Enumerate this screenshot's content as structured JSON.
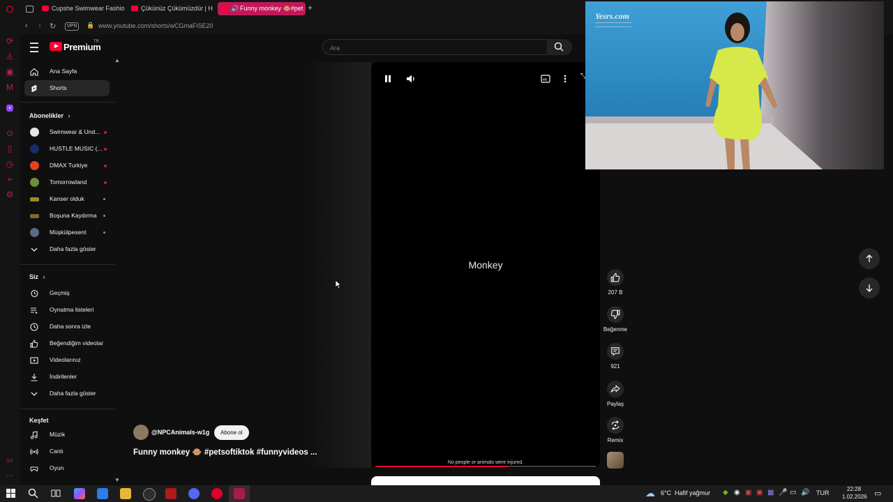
{
  "browser": {
    "tabs": [
      {
        "label": "Cupshe Swimwear Fashio"
      },
      {
        "label": "Çükünüz Çükümüzdür | H"
      },
      {
        "label": "Funny monkey 🐵#pet"
      }
    ],
    "new_tab": "+",
    "vpn_label": "VPN",
    "url": "www.youtube.com/shorts/wCGmaFiSE20"
  },
  "header": {
    "brand": "Premium",
    "brand_sup": "TR",
    "search_placeholder": "Ara"
  },
  "sidebar": {
    "main": [
      {
        "label": "Ana Sayfa",
        "icon": "home-icon"
      },
      {
        "label": "Shorts",
        "icon": "shorts-icon"
      }
    ],
    "subscriptions_title": "Abonelikler",
    "subscriptions": [
      {
        "label": "Swimwear & Und...",
        "color": "#e6e6e6",
        "status": "live"
      },
      {
        "label": "HUSTLE MUSIC (...",
        "color": "#1a2a6c",
        "status": "live"
      },
      {
        "label": "DMAX Turkiye",
        "color": "#e2431d",
        "status": "live"
      },
      {
        "label": "Tomorrowland",
        "color": "#6b8f3a",
        "status": "live"
      },
      {
        "label": "Kanser olduk",
        "color": "#9c8a2a",
        "status": "new"
      },
      {
        "label": "Boşuna Kaydırma",
        "color": "#7a6a2a",
        "status": "new"
      },
      {
        "label": "Müşkülpesent",
        "color": "#5a6a8a",
        "status": "new"
      }
    ],
    "show_more": "Daha fazla göster",
    "you_title": "Siz",
    "you": [
      {
        "label": "Geçmiş",
        "icon": "history-icon"
      },
      {
        "label": "Oynatma listeleri",
        "icon": "playlist-icon"
      },
      {
        "label": "Daha sonra izle",
        "icon": "clock-icon"
      },
      {
        "label": "Beğendiğim videolar",
        "icon": "thumbs-up-icon"
      },
      {
        "label": "Videolarınız",
        "icon": "video-icon"
      },
      {
        "label": "İndirilenler",
        "icon": "download-icon"
      }
    ],
    "show_more_2": "Daha fazla göster",
    "explore_title": "Keşfet",
    "explore": [
      {
        "label": "Müzik",
        "icon": "music-icon"
      },
      {
        "label": "Canlı",
        "icon": "live-icon"
      },
      {
        "label": "Oyun",
        "icon": "gaming-icon"
      }
    ]
  },
  "video": {
    "center_text": "Monkey",
    "caption": "No people or animals were injured.",
    "progress": 0.6
  },
  "channel": {
    "handle": "@NPCAnimals-w1g",
    "subscribe_label": "Abone ol",
    "title": "Funny monkey 🐵 #petsoftiktok #funnyvideos ..."
  },
  "actions": {
    "likes": "207 B",
    "dislike_label": "Beğenme",
    "comments": "921",
    "share_label": "Paylaş",
    "remix_label": "Remix"
  },
  "pip": {
    "watermark": "Yesrs.com"
  },
  "taskbar": {
    "temperature": "6°C",
    "weather": "Hafif yağmur",
    "language": "TUR",
    "time": "22:28",
    "date": "1.02.2026",
    "colors": {
      "accent": "#c2185b",
      "yt_red": "#ff0033"
    }
  }
}
